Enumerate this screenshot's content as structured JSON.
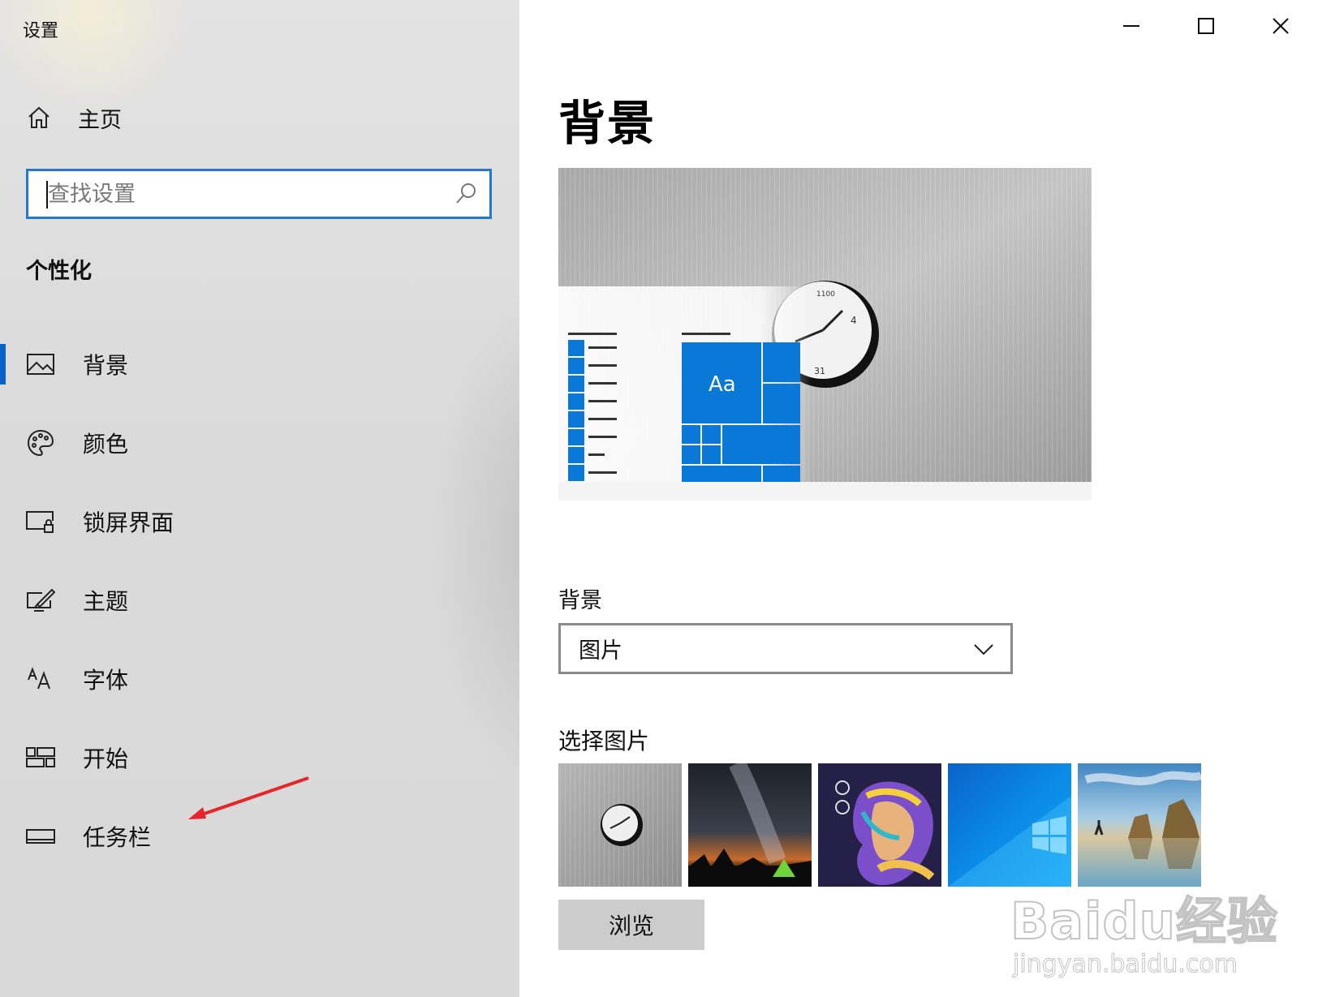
{
  "window": {
    "title": "设置"
  },
  "sidebar": {
    "home": {
      "label": "主页",
      "icon": "home-icon"
    },
    "search": {
      "placeholder": "查找设置",
      "icon": "search-icon"
    },
    "section_heading": "个性化",
    "items": [
      {
        "label": "背景",
        "icon": "picture-icon",
        "selected": true
      },
      {
        "label": "颜色",
        "icon": "palette-icon",
        "selected": false
      },
      {
        "label": "锁屏界面",
        "icon": "lock-screen-icon",
        "selected": false
      },
      {
        "label": "主题",
        "icon": "theme-brush-icon",
        "selected": false
      },
      {
        "label": "字体",
        "icon": "font-icon",
        "selected": false
      },
      {
        "label": "开始",
        "icon": "start-tiles-icon",
        "selected": false
      },
      {
        "label": "任务栏",
        "icon": "taskbar-icon",
        "selected": false
      }
    ],
    "accent_color": "#0a62c9"
  },
  "main": {
    "page_title": "背景",
    "preview": {
      "tile_text": "Aa",
      "accent_color": "#0a78d7"
    },
    "background_label": "背景",
    "background_select": {
      "value": "图片"
    },
    "choose_picture_label": "选择图片",
    "thumbnails": [
      {
        "name": "clock-wall"
      },
      {
        "name": "milky-way-tent"
      },
      {
        "name": "illustrated-warrior"
      },
      {
        "name": "windows-logo-blue"
      },
      {
        "name": "beach-rocks"
      }
    ],
    "browse_button": "浏览"
  },
  "watermark": {
    "brand": "Baidu经验",
    "url": "jingyan.baidu.com"
  }
}
